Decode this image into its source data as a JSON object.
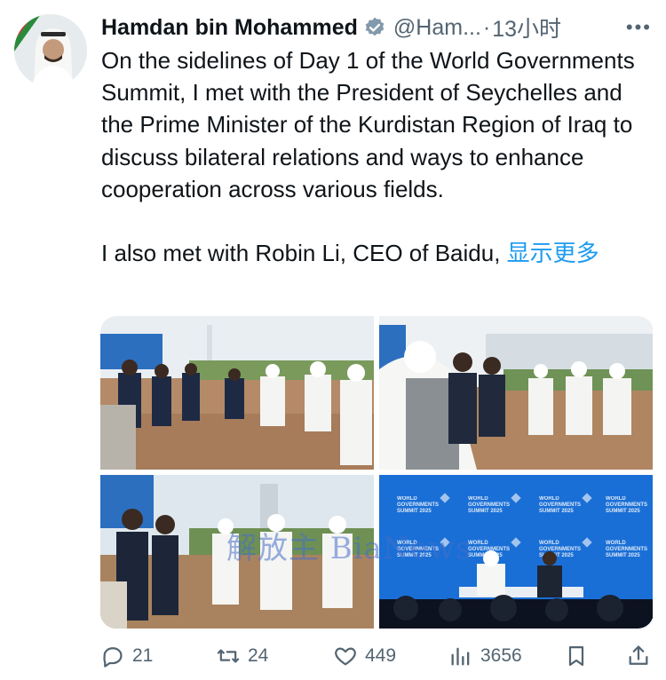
{
  "tweet": {
    "author_name": "Hamdan bin Mohammed",
    "handle": "@Ham...",
    "separator": "·",
    "time": "13小时",
    "more_label": "•••",
    "paragraph1": "On the sidelines of Day 1 of the World Governments Summit, I met with the President of Seychelles and the Prime Minister of the Kurdistan Region of Iraq to discuss bilateral relations and ways to enhance cooperation across various fields.",
    "paragraph2": "I also met with Robin Li, CEO of Baidu,",
    "show_more": "显示更多"
  },
  "media": {
    "watermark": "解放主 BiaNews",
    "stage_text": "WORLD GOVERNMENTS SUMMIT 2025"
  },
  "actions": {
    "replies": "21",
    "reposts": "24",
    "likes": "449",
    "views": "3656"
  },
  "colors": {
    "accent": "#1d9bf0",
    "secondary_text": "#536471",
    "summit_blue": "#1a6fd6"
  }
}
